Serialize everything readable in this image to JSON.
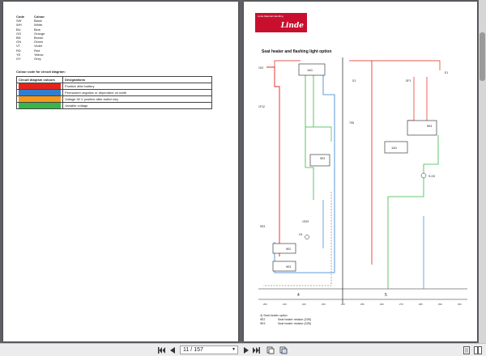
{
  "colour_codes": {
    "header": {
      "code": "Code",
      "colour": "Colour"
    },
    "rows": [
      {
        "code": "SW",
        "colour": "Black"
      },
      {
        "code": "WH",
        "colour": "White"
      },
      {
        "code": "BU",
        "colour": "Blue"
      },
      {
        "code": "OG",
        "colour": "Orange"
      },
      {
        "code": "BN",
        "colour": "Brown"
      },
      {
        "code": "GN",
        "colour": "Green"
      },
      {
        "code": "VT",
        "colour": "Violet"
      },
      {
        "code": "RD",
        "colour": "Red"
      },
      {
        "code": "YE",
        "colour": "Yellow"
      },
      {
        "code": "GY",
        "colour": "Grey"
      }
    ]
  },
  "legend": {
    "title": "Colour code for circuit diagram:",
    "header": {
      "col1": "Circuit diagram colours",
      "col2": "Designations"
    },
    "rows": [
      {
        "name": "Red",
        "color": "#e3241b",
        "designation": "Positive after battery"
      },
      {
        "name": "Blue",
        "color": "#2f7fd1",
        "designation": "Permanent negative or dependent on earth"
      },
      {
        "name": "Orange",
        "color": "#f39a1e",
        "designation": "Voltage 30 V positive after switch key"
      },
      {
        "name": "Green",
        "color": "#39b54a",
        "designation": "Variable voltage"
      }
    ]
  },
  "brand": {
    "tagline": "Linde Material Handling",
    "name": "Linde"
  },
  "diagram": {
    "title": "Seat heater and flashing light option",
    "sections": [
      "4",
      "5"
    ],
    "labels": {
      "k1": "1K2",
      "a1": "1A1",
      "f1": "1F12",
      "a2": "9E3",
      "s1": "9S3",
      "h1": "H1",
      "r1": "9E2",
      "r2": "9E3",
      "s2": "1S29",
      "k2": "S1",
      "f2": "SF1",
      "e1": "E1",
      "d1": "7S5",
      "a3": "1A1",
      "k3": "5K3",
      "h2": "S-H3"
    },
    "scale": [
      "200",
      "210",
      "220",
      "230",
      "240",
      "250",
      "260",
      "270",
      "280",
      "290",
      "300"
    ]
  },
  "notes": {
    "title": "4) Seat heater option",
    "rows": [
      {
        "code": "9E2",
        "text": "Seat heater resistor (22B)"
      },
      {
        "code": "9E3",
        "text": "Seat heater resistor (22B)"
      }
    ]
  },
  "toolbar": {
    "current_page": "11",
    "separator": "/",
    "total_pages": "157"
  }
}
